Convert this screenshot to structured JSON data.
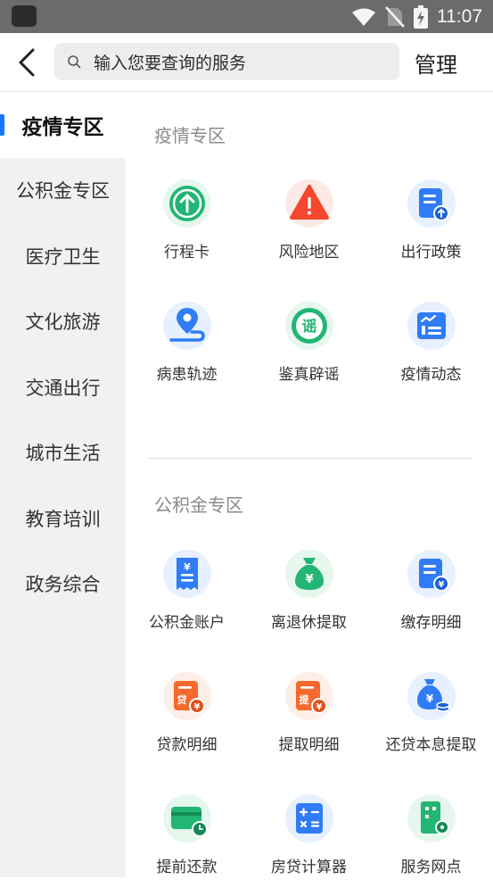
{
  "status_bar": {
    "time": "11:07"
  },
  "header": {
    "search_placeholder": "输入您要查询的服务",
    "manage_label": "管理"
  },
  "sidebar": {
    "items": [
      {
        "label": "疫情专区",
        "active": true
      },
      {
        "label": "公积金专区"
      },
      {
        "label": "医疗卫生"
      },
      {
        "label": "文化旅游"
      },
      {
        "label": "交通出行"
      },
      {
        "label": "城市生活"
      },
      {
        "label": "教育培训"
      },
      {
        "label": "政务综合"
      }
    ]
  },
  "sections": [
    {
      "title": "疫情专区",
      "items": [
        {
          "label": "行程卡",
          "icon": "arrow-up-circle-icon",
          "color": "#22b573"
        },
        {
          "label": "风险地区",
          "icon": "warning-icon",
          "color": "#f5462e"
        },
        {
          "label": "出行政策",
          "icon": "document-upload-icon",
          "color": "#2f7cf6"
        },
        {
          "label": "病患轨迹",
          "icon": "location-path-icon",
          "color": "#2f7cf6"
        },
        {
          "label": "鉴真辟谣",
          "icon": "rumor-badge-icon",
          "color": "#22b573",
          "glyph": "谣"
        },
        {
          "label": "疫情动态",
          "icon": "chart-board-icon",
          "color": "#2f7cf6"
        }
      ]
    },
    {
      "title": "公积金专区",
      "items": [
        {
          "label": "公积金账户",
          "icon": "receipt-icon",
          "color": "#2f7cf6"
        },
        {
          "label": "离退休提取",
          "icon": "money-bag-icon",
          "color": "#22b573"
        },
        {
          "label": "缴存明细",
          "icon": "document-yen-icon",
          "color": "#2f7cf6"
        },
        {
          "label": "贷款明细",
          "icon": "loan-document-icon",
          "color": "#f5692e",
          "glyph": "贷"
        },
        {
          "label": "提取明细",
          "icon": "withdraw-document-icon",
          "color": "#f5692e",
          "glyph": "提"
        },
        {
          "label": "还贷本息提取",
          "icon": "money-bag-coins-icon",
          "color": "#2f7cf6"
        },
        {
          "label": "提前还款",
          "icon": "card-clock-icon",
          "color": "#22b573"
        },
        {
          "label": "房贷计算器",
          "icon": "calculator-icon",
          "color": "#2f7cf6"
        },
        {
          "label": "服务网点",
          "icon": "building-location-icon",
          "color": "#22b573"
        }
      ]
    }
  ]
}
